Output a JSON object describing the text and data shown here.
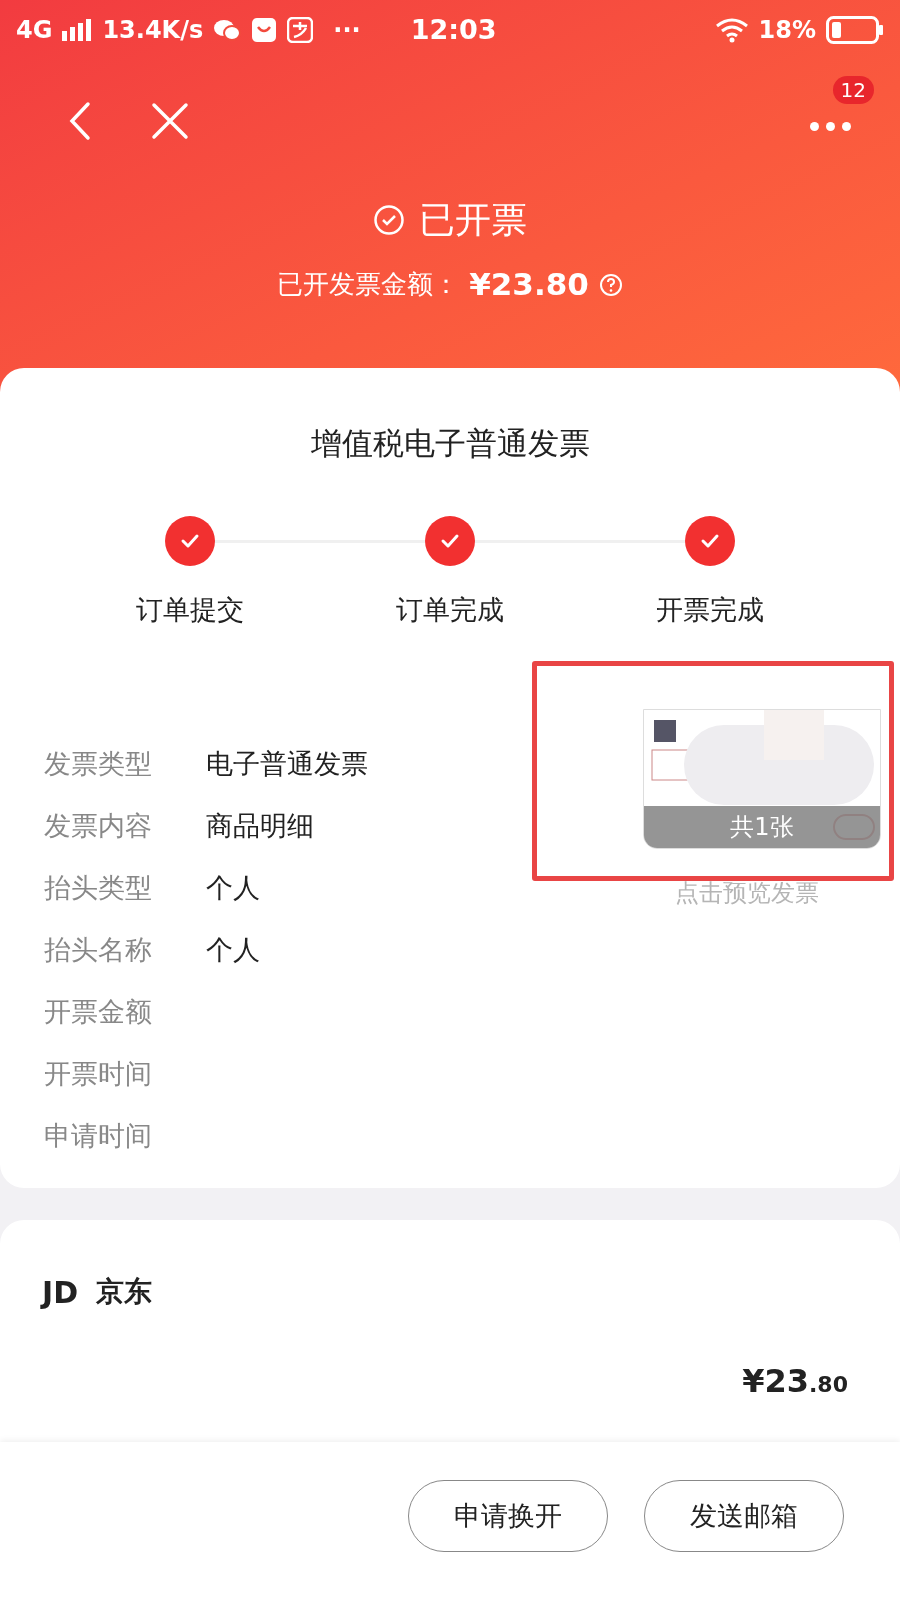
{
  "status_bar": {
    "network": "4G",
    "speed": "13.4K/s",
    "more": "···",
    "time": "12:03",
    "battery": "18%"
  },
  "nav": {
    "badge": "12"
  },
  "header": {
    "status": "已开票",
    "amount_label": "已开发票金额：",
    "amount": "¥23.80"
  },
  "invoice": {
    "title": "增值税电子普通发票",
    "steps": [
      {
        "label": "订单提交",
        "done": true
      },
      {
        "label": "订单完成",
        "done": true
      },
      {
        "label": "开票完成",
        "done": true
      }
    ],
    "fields": [
      {
        "label": "发票类型",
        "value": "电子普通发票"
      },
      {
        "label": "发票内容",
        "value": "商品明细"
      },
      {
        "label": "抬头类型",
        "value": "个人"
      },
      {
        "label": "抬头名称",
        "value": "个人"
      },
      {
        "label": "开票金额"
      },
      {
        "label": "开票时间"
      },
      {
        "label": "申请时间"
      }
    ],
    "preview": {
      "count": "共1张",
      "caption": "点击预览发票"
    }
  },
  "store": {
    "logo": "JD",
    "name": "京东",
    "price_main": "¥23",
    "price_decimal": ".80"
  },
  "actions": [
    "申请换开",
    "发送邮箱"
  ]
}
